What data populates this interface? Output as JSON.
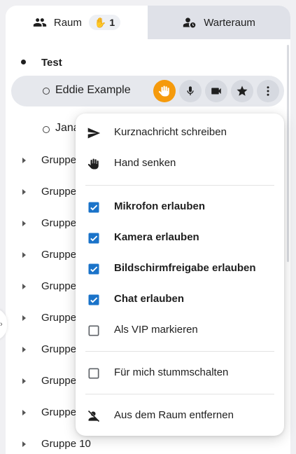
{
  "tabs": {
    "room_label": "Raum",
    "room_badge_count": "1",
    "waiting_label": "Warteraum"
  },
  "list": {
    "group_test": "Test",
    "user_selected": "Eddie Example",
    "user2": "Jana",
    "groups": [
      "Gruppe",
      "Gruppe",
      "Gruppe",
      "Gruppe",
      "Gruppe",
      "Gruppe",
      "Gruppe",
      "Gruppe",
      "Gruppe",
      "Gruppe 10"
    ]
  },
  "menu": {
    "send_message": "Kurznachricht schreiben",
    "lower_hand": "Hand senken",
    "allow_mic": "Mikrofon erlauben",
    "allow_camera": "Kamera erlauben",
    "allow_screenshare": "Bildschirmfreigabe erlauben",
    "allow_chat": "Chat erlauben",
    "mark_vip": "Als VIP markieren",
    "mute_for_me": "Für mich stummschalten",
    "remove_from_room": "Aus dem Raum entfernen",
    "checks": {
      "allow_mic": true,
      "allow_camera": true,
      "allow_screenshare": true,
      "allow_chat": true,
      "mark_vip": false,
      "mute_for_me": false
    }
  },
  "colors": {
    "accent_blue": "#1a73c9",
    "hand_orange": "#f59a0c",
    "selected_row": "#e6e8ed"
  }
}
